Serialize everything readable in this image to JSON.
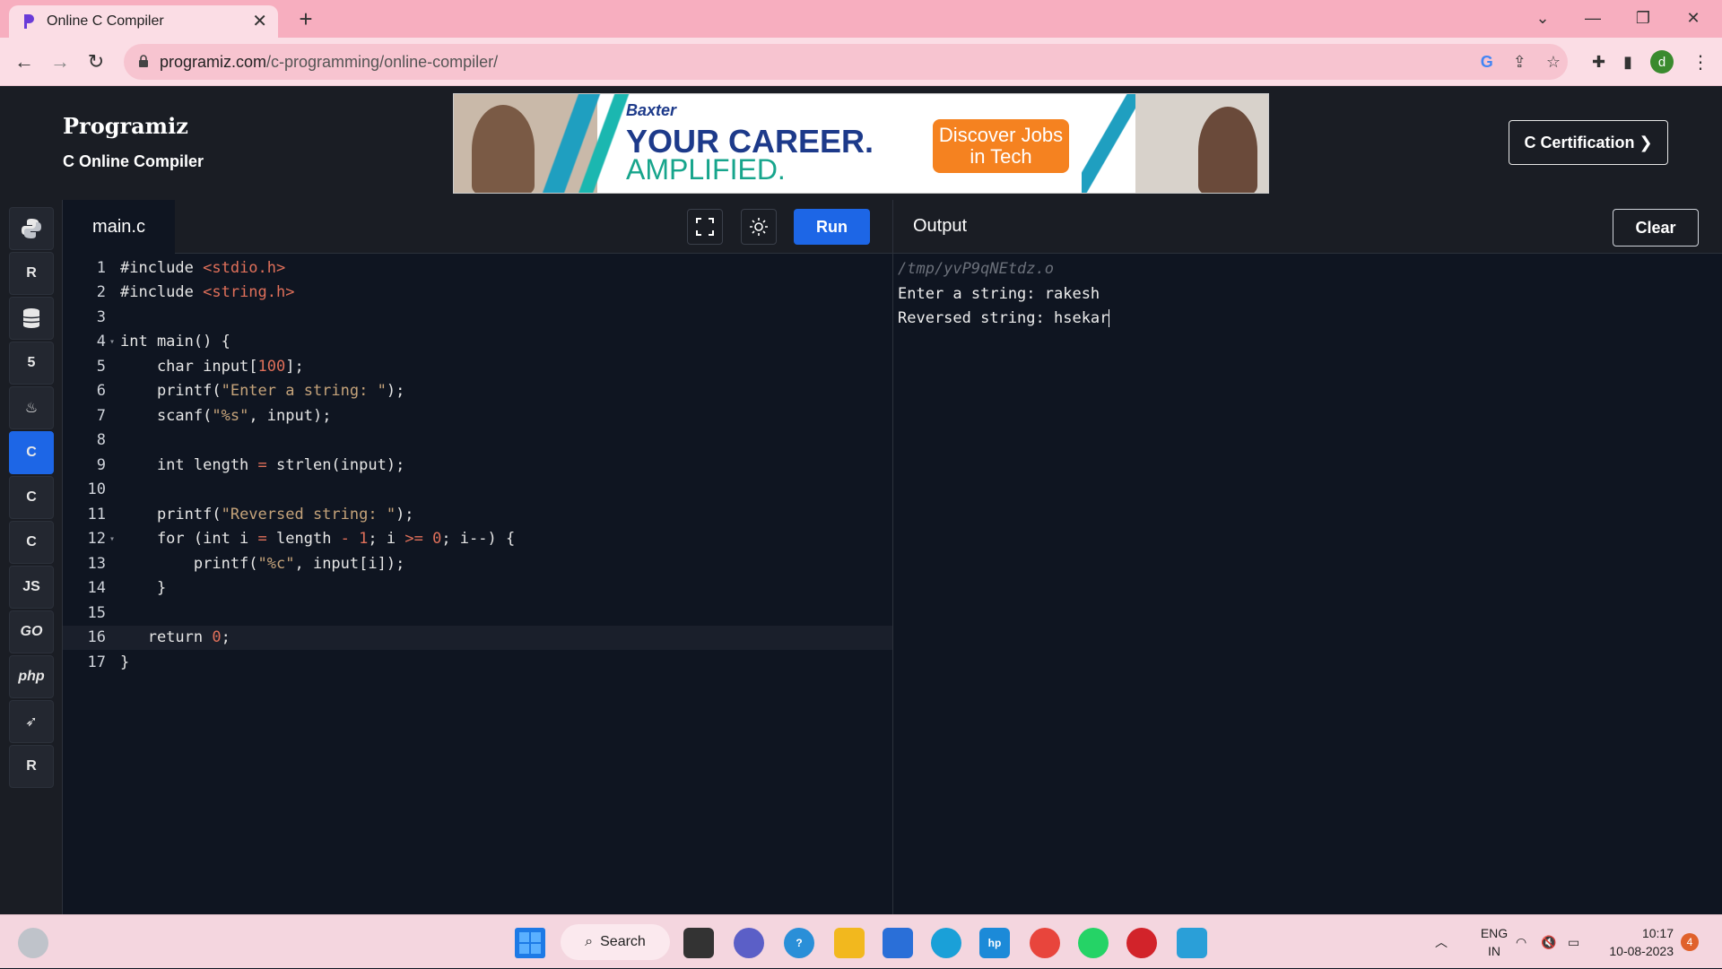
{
  "browser": {
    "tab_title": "Online C Compiler",
    "url_domain": "programiz.com",
    "url_path": "/c-programming/online-compiler/",
    "avatar_letter": "d"
  },
  "header": {
    "logo": "Programiz",
    "subtitle": "C Online Compiler",
    "ad": {
      "brand": "Baxter",
      "line1": "YOUR CAREER.",
      "line2": "AMPLIFIED.",
      "cta": "Discover Jobs in Tech"
    },
    "cert_button": "C Certification ❯"
  },
  "rail": {
    "items": [
      {
        "name": "python",
        "label": "",
        "active": false
      },
      {
        "name": "r",
        "label": "R",
        "active": false
      },
      {
        "name": "sql",
        "label": "",
        "active": false
      },
      {
        "name": "html",
        "label": "5",
        "active": false
      },
      {
        "name": "java",
        "label": "",
        "active": false
      },
      {
        "name": "c",
        "label": "C",
        "active": true
      },
      {
        "name": "cpp",
        "label": "C",
        "active": false
      },
      {
        "name": "csharp",
        "label": "C",
        "active": false
      },
      {
        "name": "js",
        "label": "JS",
        "active": false
      },
      {
        "name": "go",
        "label": "GO",
        "active": false
      },
      {
        "name": "php",
        "label": "php",
        "active": false
      },
      {
        "name": "swift",
        "label": "",
        "active": false
      },
      {
        "name": "rust",
        "label": "R",
        "active": false
      }
    ]
  },
  "editor": {
    "file_tab": "main.c",
    "run_label": "Run",
    "lines": [
      "#include <stdio.h>",
      "#include <string.h>",
      "",
      "int main() {",
      "    char input[100];",
      "    printf(\"Enter a string: \");",
      "    scanf(\"%s\", input);",
      "",
      "    int length = strlen(input);",
      "",
      "    printf(\"Reversed string: \");",
      "    for (int i = length - 1; i >= 0; i--) {",
      "        printf(\"%c\", input[i]);",
      "    }",
      "",
      "   return 0;",
      "}"
    ]
  },
  "output": {
    "title": "Output",
    "clear_label": "Clear",
    "path": "/tmp/yvP9qNEtdz.o",
    "line1": "Enter a string: rakesh",
    "line2": "Reversed string: hsekar"
  },
  "taskbar": {
    "search_label": "Search",
    "lang_line1": "ENG",
    "lang_line2": "IN",
    "time": "10:17",
    "date": "10-08-2023",
    "notifications": "4"
  }
}
